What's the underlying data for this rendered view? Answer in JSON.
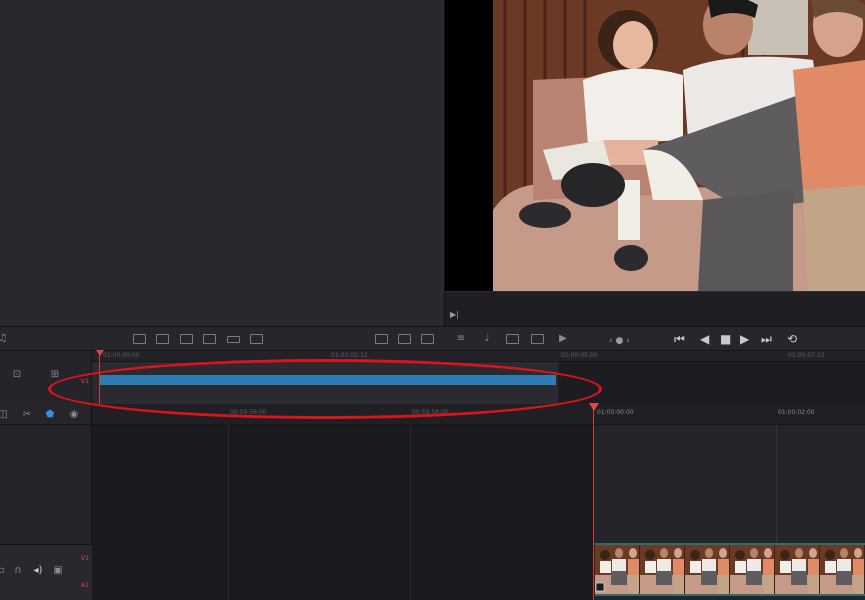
{
  "colors": {
    "playhead": "#e04848",
    "clip": "#2d7cb4",
    "highlight": "#d9141b",
    "track_label": "#d24a4a"
  },
  "toolbar": {
    "left_icons": [
      "music-note-icon"
    ],
    "center_icons": [
      "insert-clip-icon",
      "overwrite-clip-icon",
      "replace-clip-icon",
      "fit-to-fill-icon",
      "append-icon",
      "ripple-overwrite-icon"
    ],
    "right_icons": [
      "layout-1-icon",
      "layout-2-icon",
      "layout-3-icon"
    ],
    "viewer_icons": [
      "mixer-icon",
      "mic-icon",
      "video-out-icon",
      "audio-out-icon",
      "play-out-icon"
    ],
    "jog_label": "‹ ● ›"
  },
  "transport": {
    "first": "⏮",
    "prev": "◀",
    "stop": "■",
    "play": "▶",
    "last": "⏭",
    "loop": "⟲"
  },
  "upper_timeline": {
    "ticks": [
      "01:00:00:00",
      "01:00:02:12",
      "01:00:05:00",
      "01:00:07:12"
    ],
    "track_label": "V1"
  },
  "lower_timeline": {
    "ticks_left": [
      "00:59:56:00",
      "00:59:58:00"
    ],
    "ticks_right": [
      "01:00:00:00",
      "01:00:02:00"
    ],
    "track_labels": [
      "V1",
      "A1"
    ]
  },
  "viewer": {
    "mini_icon": "play-end-icon"
  }
}
